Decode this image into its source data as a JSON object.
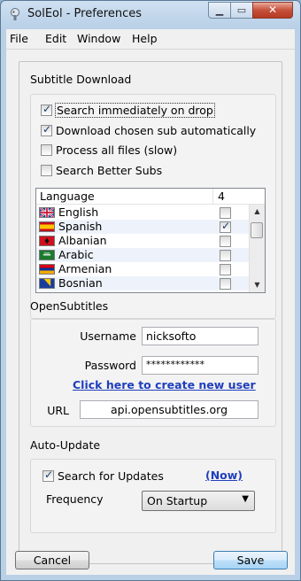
{
  "window": {
    "title": "SolEol - Preferences",
    "icon": "app-icon"
  },
  "menu": [
    "File",
    "Edit",
    "Window",
    "Help"
  ],
  "subtitle_download": {
    "label": "Subtitle Download",
    "options": [
      {
        "label": "Search immediately on drop",
        "checked": true
      },
      {
        "label": "Download chosen sub automatically",
        "checked": true
      },
      {
        "label": "Process all files (slow)",
        "checked": false
      },
      {
        "label": "Search Better Subs",
        "checked": false
      }
    ],
    "languages": {
      "header_language": "Language",
      "header_count": "4",
      "rows": [
        {
          "name": "English",
          "checked": false,
          "flag": "uk-flag"
        },
        {
          "name": "Spanish",
          "checked": true,
          "flag": "spain-flag"
        },
        {
          "name": "Albanian",
          "checked": false,
          "flag": "albania-flag"
        },
        {
          "name": "Arabic",
          "checked": false,
          "flag": "arabic-flag"
        },
        {
          "name": "Armenian",
          "checked": false,
          "flag": "armenia-flag"
        },
        {
          "name": "Bosnian",
          "checked": false,
          "flag": "bosnia-flag"
        }
      ]
    }
  },
  "opensubtitles": {
    "label": "OpenSubtitles",
    "username_label": "Username",
    "username": "nicksofto",
    "password_label": "Password",
    "password": "************",
    "create_user": "Click here to create new user",
    "url_label": "URL",
    "url": "api.opensubtitles.org"
  },
  "auto_update": {
    "label": "Auto-Update",
    "search_label": "Search for Updates",
    "search_checked": true,
    "now_link": "(Now)",
    "frequency_label": "Frequency",
    "frequency": "On Startup"
  },
  "buttons": {
    "cancel": "Cancel",
    "save": "Save"
  },
  "colors": {
    "link": "#1f3fbd",
    "titlebar": "#b9d0e7",
    "row_alt": "#eef3fb"
  }
}
